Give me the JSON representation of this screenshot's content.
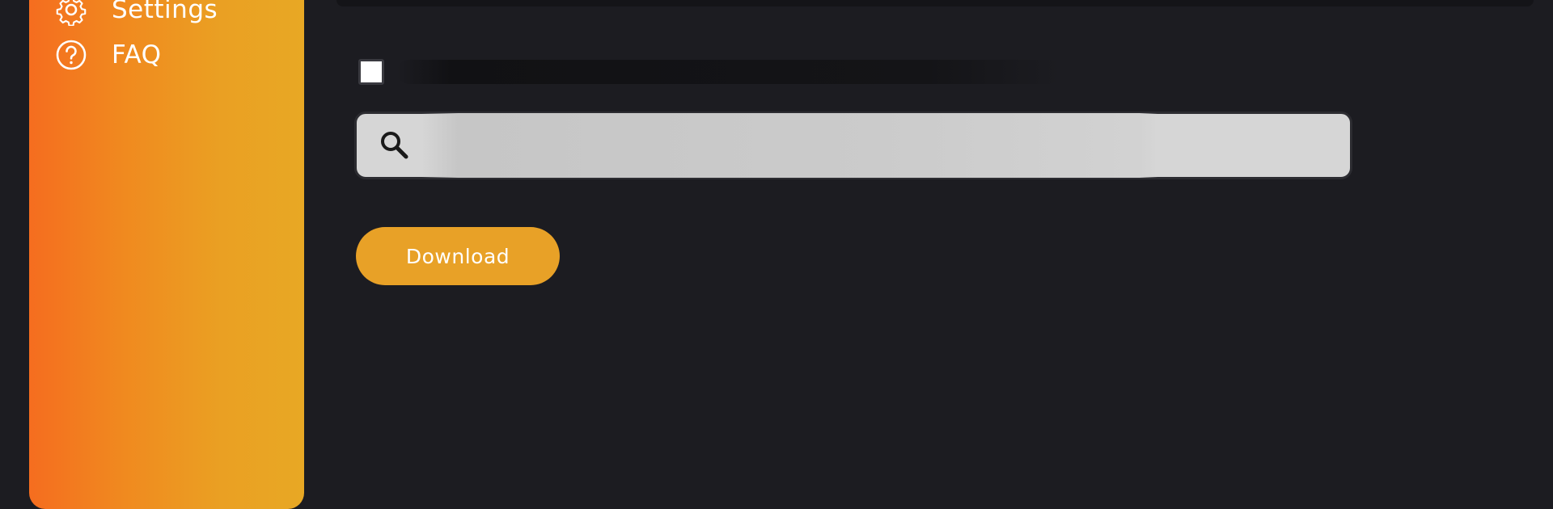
{
  "sidebar": {
    "items": [
      {
        "label": "Settings",
        "icon": "gear-icon"
      },
      {
        "label": "FAQ",
        "icon": "question-circle-icon"
      }
    ],
    "gradient_colors": [
      "#f56d1f",
      "#e8a824"
    ]
  },
  "main": {
    "checkbox": {
      "label": "",
      "checked": false
    },
    "search": {
      "value": "",
      "placeholder": "",
      "icon": "search-icon"
    },
    "download_button": {
      "label": "Download",
      "color": "#e8a127"
    }
  },
  "colors": {
    "background": "#1c1c21",
    "search_background": "#d6d6d6",
    "text_light": "#ffffff"
  }
}
